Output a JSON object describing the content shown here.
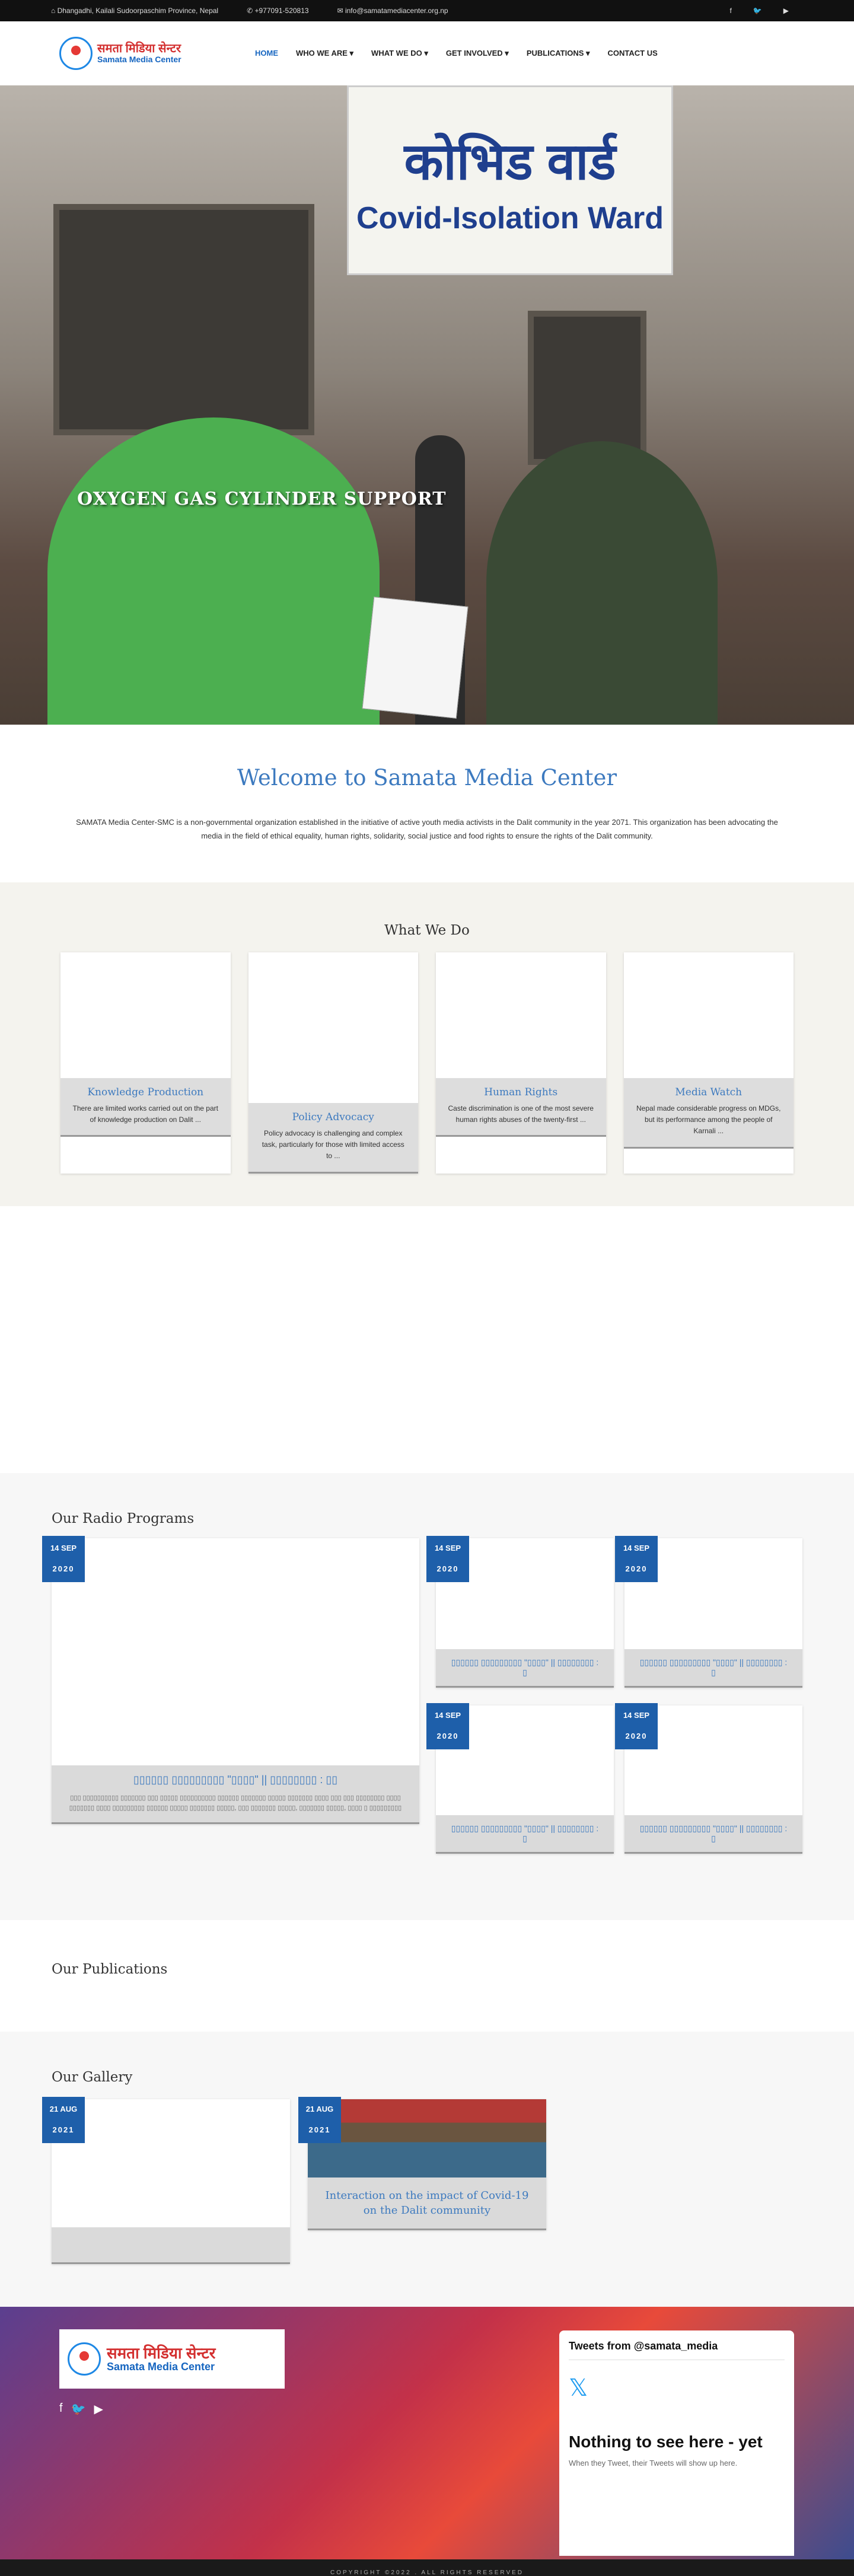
{
  "topbar": {
    "address": "Dhangadhi, Kailali Sudoorpaschim Province, Nepal",
    "phone": "+977091-520813",
    "email": "info@samatamediacenter.org.np",
    "social_icons": [
      "facebook-icon",
      "twitter-icon",
      "youtube-icon"
    ]
  },
  "brand": {
    "name_np": "समता मिडिया सेन्टर",
    "name_en": "Samata Media Center"
  },
  "nav": [
    "HOME",
    "WHO WE ARE ▾",
    "WHAT WE DO ▾",
    "GET INVOLVED ▾",
    "PUBLICATIONS ▾",
    "CONTACT US"
  ],
  "hero": {
    "sign_line1": "कोभिड वार्ड",
    "sign_line2": "Covid-Isolation Ward",
    "caption": "OXYGEN GAS CYLINDER SUPPORT"
  },
  "welcome": {
    "title": "Welcome to Samata Media Center",
    "text": "SAMATA Media Center-SMC is a non-governmental organization established in the initiative of active youth media activists in the Dalit community in the year 2071. This organization has been advocating the media in the field of ethical equality, human rights, solidarity, social justice and food rights to ensure the rights of the Dalit community."
  },
  "what_we_do": {
    "title": "What We Do",
    "cards": [
      {
        "title": "Knowledge Production",
        "desc": "There are limited works carried out on the part of knowledge production on Dalit ..."
      },
      {
        "title": "Policy Advocacy",
        "desc": "Policy advocacy is challenging and complex task, particularly for those with limited access to ..."
      },
      {
        "title": "Human Rights",
        "desc": "Caste discrimination is one of the most severe human rights abuses of the twenty-first ..."
      },
      {
        "title": "Media Watch",
        "desc": "Nepal made considerable progress on MDGs, but its performance among the people of Karnali ..."
      }
    ]
  },
  "radio": {
    "title": "Our Radio Programs",
    "featured": {
      "day": "14 SEP",
      "year": "2020",
      "title": "▯▯▯▯▯▯ ▯▯▯▯▯▯▯▯▯ \"▯▯▯▯\" || ▯▯▯▯▯▯▯▯ : ▯▯",
      "desc": "▯▯▯ ▯▯▯▯▯▯▯▯▯▯ ▯▯▯▯▯▯▯ ▯▯▯ ▯▯▯▯▯ ▯▯▯▯▯▯▯▯▯▯ ▯▯▯▯▯▯ ▯▯▯▯▯▯▯ ▯▯▯▯▯ ▯▯▯▯▯▯▯ ▯▯▯▯ ▯▯▯ ▯▯▯ ▯▯▯▯▯▯▯▯ ▯▯▯▯ ▯▯▯▯▯▯▯ ▯▯▯▯ ▯▯▯▯▯▯▯▯▯ ▯▯▯▯▯▯ ▯▯▯▯▯ ▯▯▯▯▯▯▯ ▯▯▯▯▯, ▯▯▯ ▯▯▯▯▯▯▯ ▯▯▯▯▯, ▯▯▯▯▯▯▯ ▯▯▯▯▯, ▯▯▯▯ ▯ ▯▯▯▯▯▯▯▯▯"
    },
    "items": [
      {
        "day": "14 SEP",
        "year": "2020",
        "title": "▯▯▯▯▯▯ ▯▯▯▯▯▯▯▯▯ \"▯▯▯▯\" || ▯▯▯▯▯▯▯▯ : ▯"
      },
      {
        "day": "14 SEP",
        "year": "2020",
        "title": "▯▯▯▯▯▯ ▯▯▯▯▯▯▯▯▯ \"▯▯▯▯\" || ▯▯▯▯▯▯▯▯ : ▯"
      },
      {
        "day": "14 SEP",
        "year": "2020",
        "title": "▯▯▯▯▯▯ ▯▯▯▯▯▯▯▯▯ \"▯▯▯▯\" || ▯▯▯▯▯▯▯▯ : ▯"
      },
      {
        "day": "14 SEP",
        "year": "2020",
        "title": "▯▯▯▯▯▯ ▯▯▯▯▯▯▯▯▯ \"▯▯▯▯\" || ▯▯▯▯▯▯▯▯ : ▯"
      }
    ]
  },
  "publications": {
    "title": "Our Publications"
  },
  "gallery": {
    "title": "Our Gallery",
    "items": [
      {
        "day": "21 AUG",
        "year": "2021",
        "title": ""
      },
      {
        "day": "21 AUG",
        "year": "2021",
        "title": "Interaction on the impact of Covid-19 on the Dalit community"
      }
    ]
  },
  "footer": {
    "tweets_header": "Tweets from @samata_media",
    "tweets_empty_title": "Nothing to see here - yet",
    "tweets_empty_text": "When they Tweet, their Tweets will show up here.",
    "copyright": "COPYRIGHT ©2022 . ALL RIGHTS RESERVED"
  },
  "colors": {
    "accent": "#3d7abf",
    "date_badge": "#1e5faa",
    "topbar": "#111111"
  }
}
